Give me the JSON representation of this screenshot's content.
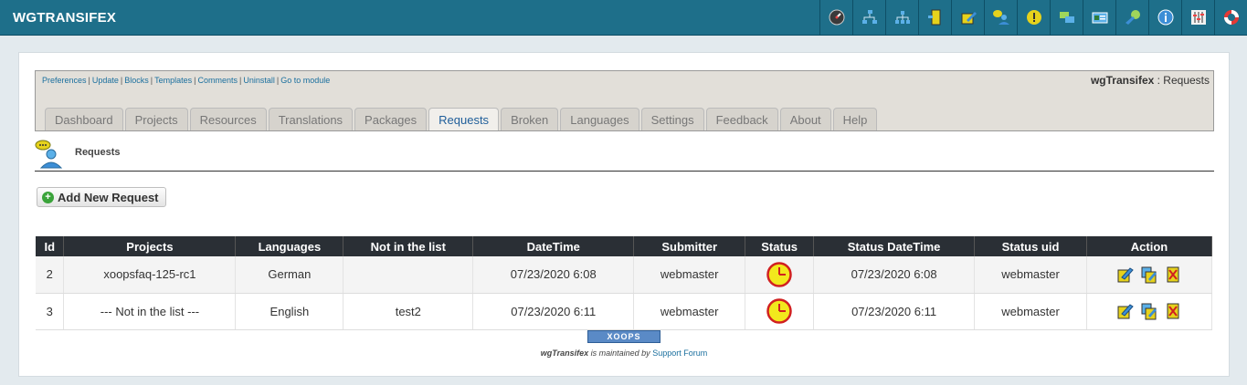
{
  "app": {
    "title": "WGTRANSIFEX"
  },
  "toolbar_icons": [
    "dashboard-gauge-icon",
    "projects-tree-icon",
    "resources-network-icon",
    "translations-door-icon",
    "packages-edit-icon",
    "requests-user-icon",
    "broken-alert-icon",
    "languages-chat-icon",
    "settings-card-icon",
    "feedback-satellite-icon",
    "about-info-icon",
    "preferences-sliders-icon",
    "help-lifebuoy-icon"
  ],
  "admin": {
    "links": [
      "Preferences",
      "Update",
      "Blocks",
      "Templates",
      "Comments",
      "Uninstall",
      "Go to module"
    ],
    "module_name": "wgTransifex",
    "title_suffix": " : Requests"
  },
  "tabs": [
    {
      "label": "Dashboard",
      "active": false
    },
    {
      "label": "Projects",
      "active": false
    },
    {
      "label": "Resources",
      "active": false
    },
    {
      "label": "Translations",
      "active": false
    },
    {
      "label": "Packages",
      "active": false
    },
    {
      "label": "Requests",
      "active": true
    },
    {
      "label": "Broken",
      "active": false
    },
    {
      "label": "Languages",
      "active": false
    },
    {
      "label": "Settings",
      "active": false
    },
    {
      "label": "Feedback",
      "active": false
    },
    {
      "label": "About",
      "active": false
    },
    {
      "label": "Help",
      "active": false
    }
  ],
  "page": {
    "heading": "Requests",
    "add_button": "Add New Request"
  },
  "table": {
    "headers": [
      "Id",
      "Projects",
      "Languages",
      "Not in the list",
      "DateTime",
      "Submitter",
      "Status",
      "Status DateTime",
      "Status uid",
      "Action"
    ],
    "rows": [
      {
        "id": "2",
        "project": "xoopsfaq-125-rc1",
        "language": "German",
        "not_in_list": "",
        "datetime": "07/23/2020 6:08",
        "submitter": "webmaster",
        "status": "clock-icon",
        "status_datetime": "07/23/2020 6:08",
        "status_uid": "webmaster"
      },
      {
        "id": "3",
        "project": "--- Not in the list ---",
        "language": "English",
        "not_in_list": "test2",
        "datetime": "07/23/2020 6:11",
        "submitter": "webmaster",
        "status": "clock-icon",
        "status_datetime": "07/23/2020 6:11",
        "status_uid": "webmaster"
      }
    ]
  },
  "footer": {
    "badge": "XOOPS",
    "module": "wgTransifex",
    "text": " is maintained by ",
    "link": "Support Forum"
  },
  "colors": {
    "header": "#1e6f8a",
    "table_header": "#2a2f35",
    "tab_active_text": "#1f5e9a",
    "status_clock": "#f2e81d"
  }
}
